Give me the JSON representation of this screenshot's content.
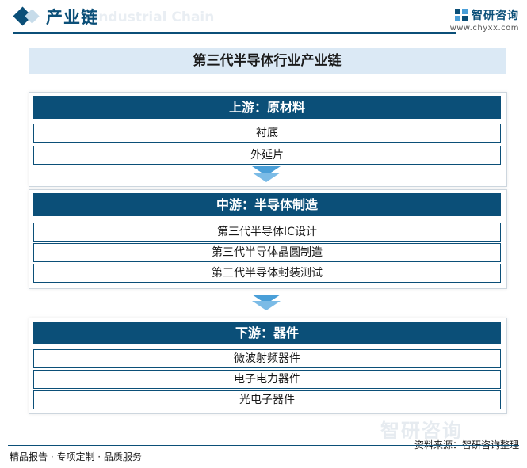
{
  "header": {
    "title": "产业链",
    "watermark": "Industrial Chain",
    "logo_name": "智研咨询",
    "logo_url": "www.chyxx.com"
  },
  "diagram": {
    "title": "第三代半导体行业产业链",
    "sections": [
      {
        "heading": "上游：原材料",
        "items": [
          "衬底",
          "外延片"
        ]
      },
      {
        "heading": "中游：半导体制造",
        "items": [
          "第三代半导体IC设计",
          "第三代半导体晶圆制造",
          "第三代半导体封装测试"
        ]
      },
      {
        "heading": "下游：器件",
        "items": [
          "微波射频器件",
          "电子电力器件",
          "光电子器件"
        ]
      }
    ]
  },
  "footer": {
    "left": "精品报告 · 专项定制 · 品质服务",
    "source": "资料来源：智研咨询整理",
    "watermark": "智研咨询"
  },
  "colors": {
    "primary": "#0b4f78",
    "title_band": "#dbe9f5",
    "arrow": "#4a9fd8"
  }
}
